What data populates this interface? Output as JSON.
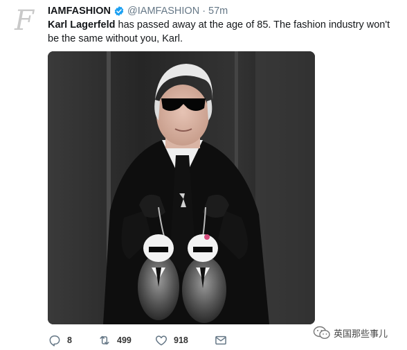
{
  "account": {
    "display_name": "IAMFASHION",
    "handle": "@IAMFASHION",
    "separator": "·",
    "timestamp": "57m",
    "avatar_letter": "F"
  },
  "tweet": {
    "name_mention": "Karl Lagerfeld",
    "text_rest": " has passed away at the age of 85. The fashion industry won't be the same without you, Karl."
  },
  "actions": {
    "reply_count": "8",
    "retweet_count": "499",
    "like_count": "918"
  },
  "watermark": {
    "text": "英国那些事儿"
  },
  "colors": {
    "verified": "#1da1f2",
    "secondary_text": "#657786",
    "icon": "#657786"
  }
}
